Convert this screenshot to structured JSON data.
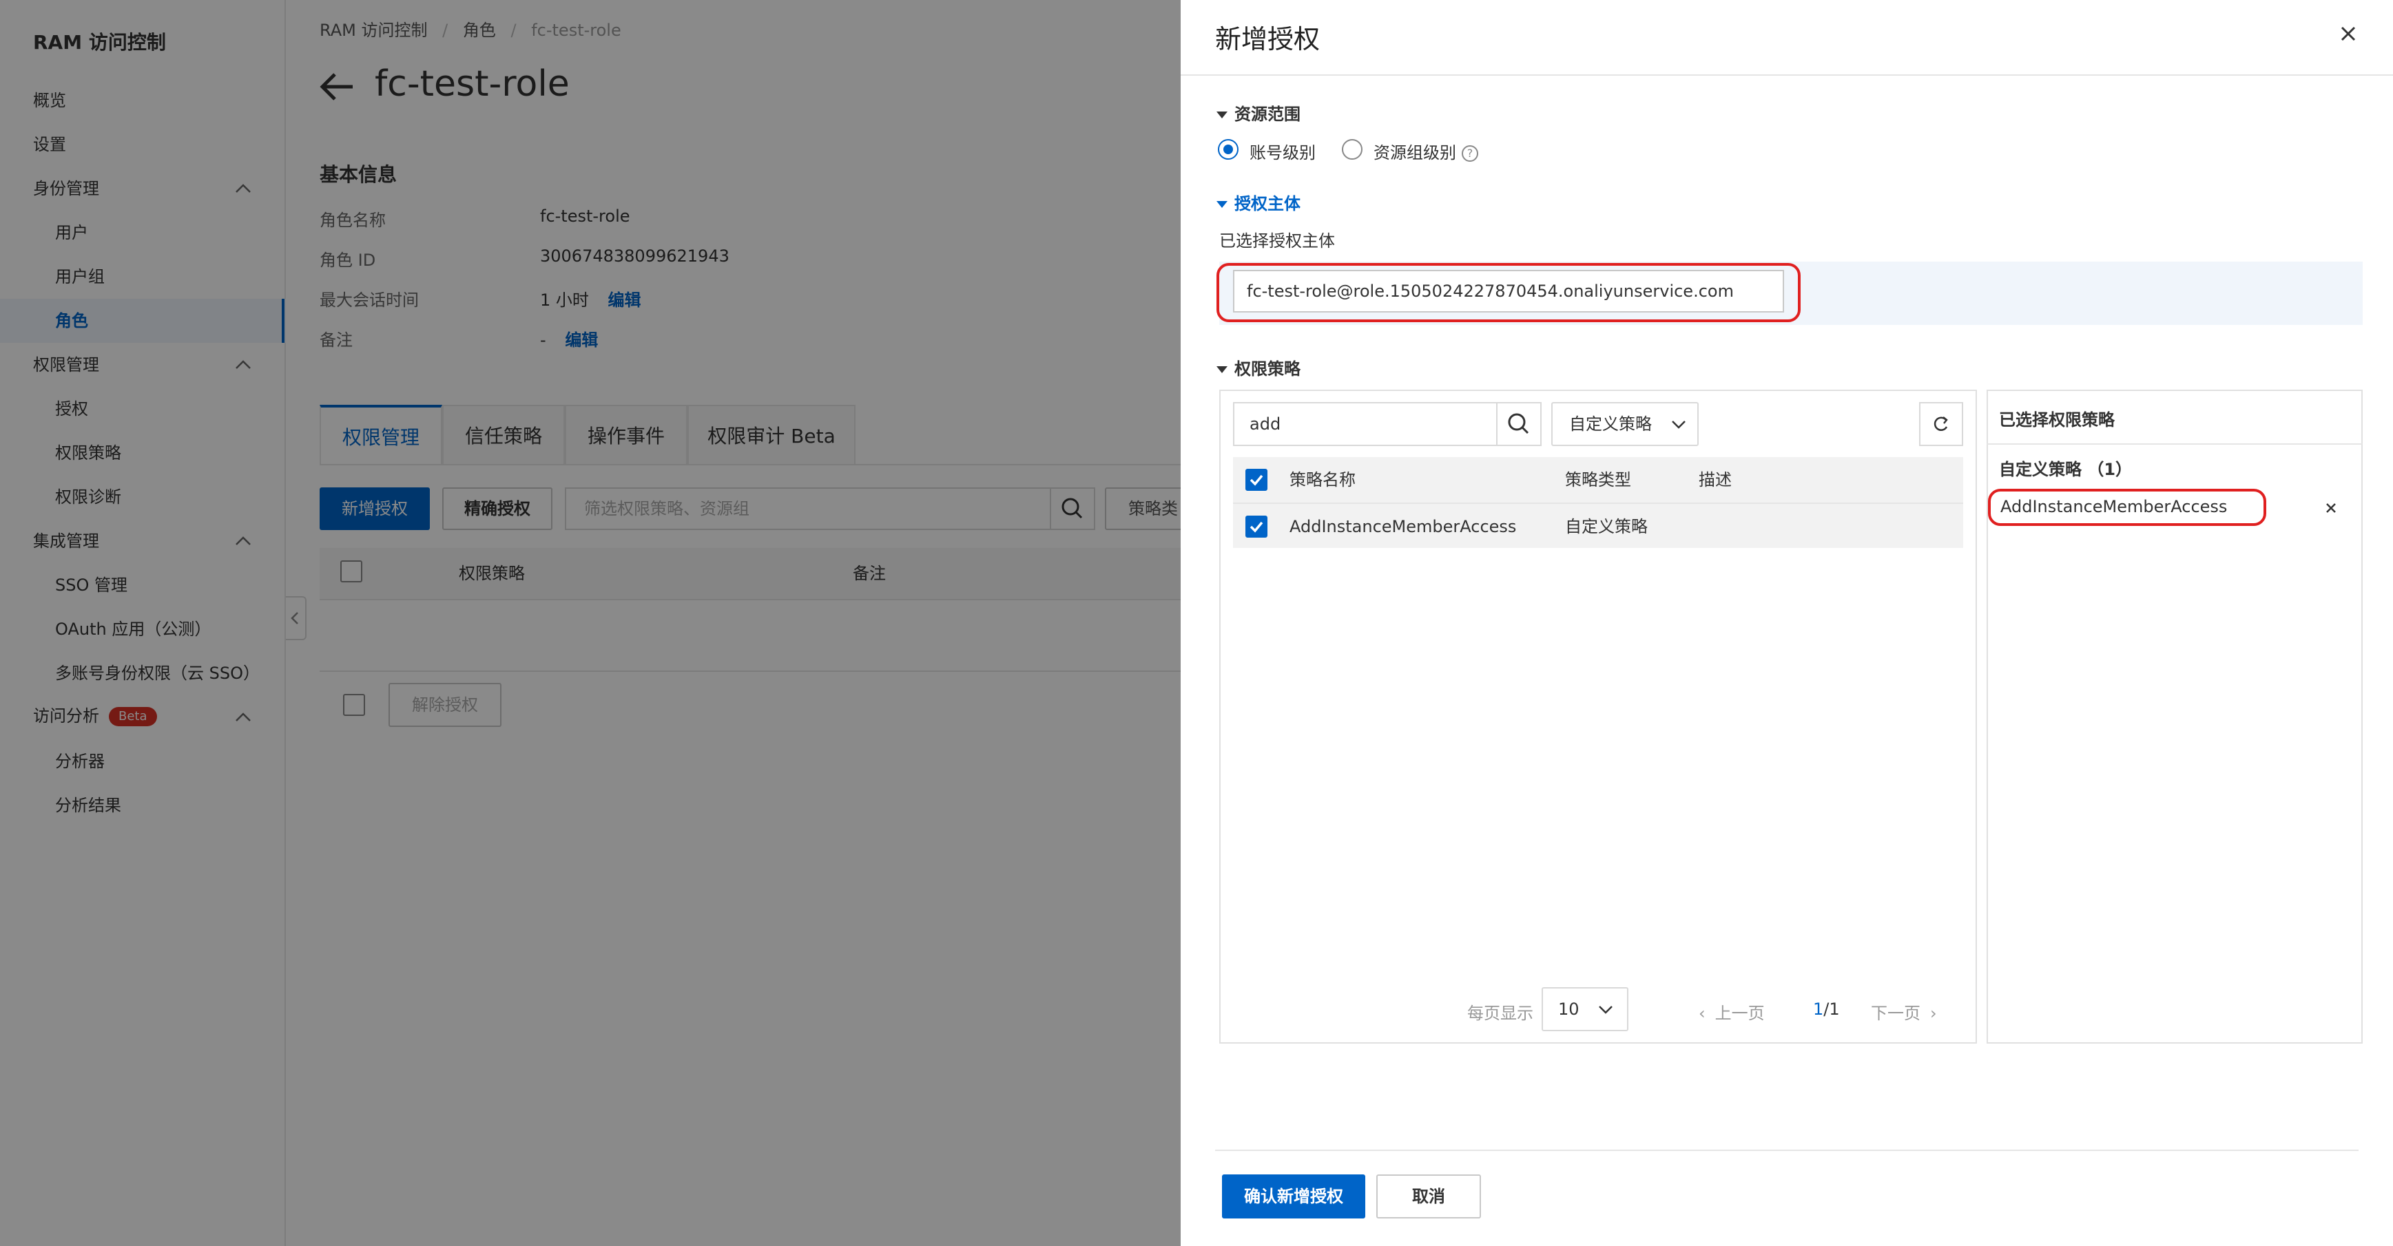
{
  "sidebar": {
    "title": "RAM 访问控制",
    "items": [
      {
        "label": "概览"
      },
      {
        "label": "设置"
      },
      {
        "label": "身份管理"
      },
      {
        "label": "用户"
      },
      {
        "label": "用户组"
      },
      {
        "label": "角色"
      },
      {
        "label": "权限管理"
      },
      {
        "label": "授权"
      },
      {
        "label": "权限策略"
      },
      {
        "label": "权限诊断"
      },
      {
        "label": "集成管理"
      },
      {
        "label": "SSO 管理"
      },
      {
        "label": "OAuth 应用（公测）"
      },
      {
        "label": "多账号身份权限（云 SSO）"
      },
      {
        "label": "访问分析"
      },
      {
        "label": "分析器"
      },
      {
        "label": "分析结果"
      }
    ],
    "active_item": "角色",
    "beta_badge": "Beta"
  },
  "breadcrumb": [
    "RAM 访问控制",
    "角色",
    "fc-test-role"
  ],
  "page": {
    "title": "fc-test-role",
    "basic_info_title": "基本信息",
    "fields": [
      {
        "label": "角色名称",
        "value": "fc-test-role"
      },
      {
        "label": "角色 ID",
        "value": "300674838099621943"
      },
      {
        "label": "最大会话时间",
        "value": "1 小时",
        "action": "编辑"
      },
      {
        "label": "备注",
        "value": "-",
        "action": "编辑"
      }
    ],
    "tabs": [
      "权限管理",
      "信任策略",
      "操作事件",
      "权限审计 Beta"
    ],
    "active_tab": "权限管理",
    "toolbar": {
      "add_button": "新增授权",
      "precise_button": "精确授权",
      "filter_placeholder": "筛选权限策略、资源组",
      "policy_type_select": "策略类"
    },
    "table_headers": [
      "权限策略",
      "备注"
    ],
    "revoke_button": "解除授权"
  },
  "drawer": {
    "title": "新增授权",
    "resource_scope": {
      "title": "资源范围",
      "options": [
        "账号级别",
        "资源组级别"
      ],
      "selected": "账号级别"
    },
    "principal": {
      "title": "授权主体",
      "label": "已选择授权主体",
      "value": "fc-test-role@role.1505024227870454.onaliyunservice.com"
    },
    "policy": {
      "title": "权限策略",
      "search_value": "add",
      "type_select": "自定义策略",
      "headers": [
        "策略名称",
        "策略类型",
        "描述"
      ],
      "rows": [
        {
          "name": "AddInstanceMemberAccess",
          "type": "自定义策略",
          "desc": ""
        }
      ],
      "pagination": {
        "per_page_label": "每页显示",
        "per_page": "10",
        "prev": "上一页",
        "current": "1",
        "total": "/1",
        "next": "下一页"
      }
    },
    "selected_policies": {
      "title": "已选择权限策略",
      "group_label": "自定义策略 （1）",
      "items": [
        "AddInstanceMemberAccess"
      ]
    },
    "confirm_button": "确认新增授权",
    "cancel_button": "取消"
  }
}
